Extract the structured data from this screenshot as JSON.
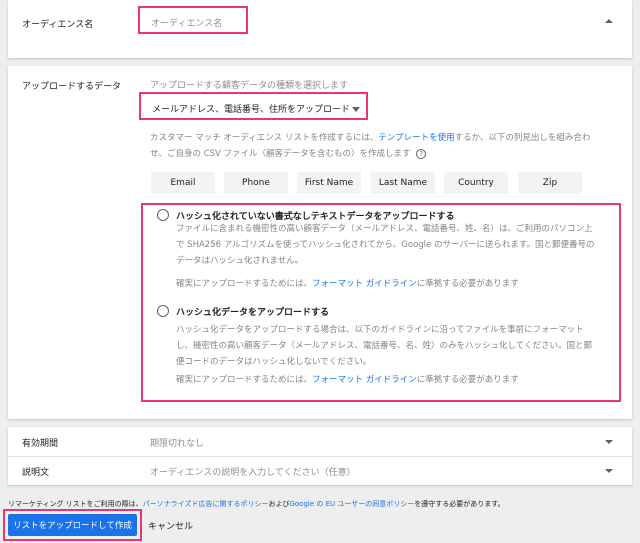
{
  "audience_name": {
    "label": "オーディエンス名",
    "placeholder": "オーディエンス名"
  },
  "upload": {
    "label": "アップロードするデータ",
    "hint": "アップロードする顧客データの種類を選択します",
    "dropdown_value": "メールアドレス、電話番号、住所をアップロード",
    "desc_prefix": "カスタマー マッチ オーディエンス リストを作成するには、",
    "template_link": "テンプレートを使用",
    "desc_suffix_line1": "するか、以下の列見出しを組み合わ",
    "desc_line2": "せ、ご自身の CSV ファイル（顧客データを含むもの）を作成します",
    "columns": [
      "Email",
      "Phone",
      "First Name",
      "Last Name",
      "Country",
      "Zip"
    ],
    "option1": {
      "title": "ハッシュ化されていない書式なしテキストデータをアップロードする",
      "line1": "ファイルに含まれる機密性の高い顧客データ（メールアドレス、電話番号、姓、名）は、ご利用のパソコン上",
      "line2": "で SHA256 アルゴリズムを使ってハッシュ化されてから、Google のサーバーに送られます。国と郵便番号の",
      "line3": "データはハッシュ化されません。",
      "note_prefix": "確実にアップロードするためには、",
      "note_link": "フォーマット ガイドライン",
      "note_suffix": "に準拠する必要があります"
    },
    "option2": {
      "title": "ハッシュ化データをアップロードする",
      "line1": "ハッシュ化データをアップロードする場合は、以下のガイドラインに沿ってファイルを事前にフォーマット",
      "line2": "し、機密性の高い顧客データ（メールアドレス、電話番号、名、姓）のみをハッシュ化してください。国と郵",
      "line3": "便コードのデータはハッシュ化しないでください。",
      "note_prefix": "確実にアップロードするためには、",
      "note_link": "フォーマット ガイドライン",
      "note_suffix": "に準拠する必要があります"
    }
  },
  "expiry": {
    "label": "有効期間",
    "value": "期限切れなし"
  },
  "description": {
    "label": "説明文",
    "placeholder": "オーディエンスの説明を入力してください（任意）"
  },
  "footer": {
    "policy_prefix": "リマーケティング リストをご利用の際は、",
    "policy_link1": "パーソナライズド広告に関するポリシー",
    "policy_mid": "および",
    "policy_link2": "Google の EU ユーザーの同意ポリシー",
    "policy_suffix": "を遵守する必要があります。",
    "create_button": "リストをアップロードして作成",
    "cancel_button": "キャンセル"
  },
  "colors": {
    "accent": "#1a73e8",
    "highlight": "#e8337d"
  },
  "icons": [
    "chevron-up-icon",
    "dropdown-arrow-icon",
    "help-icon",
    "chevron-down-icon"
  ]
}
